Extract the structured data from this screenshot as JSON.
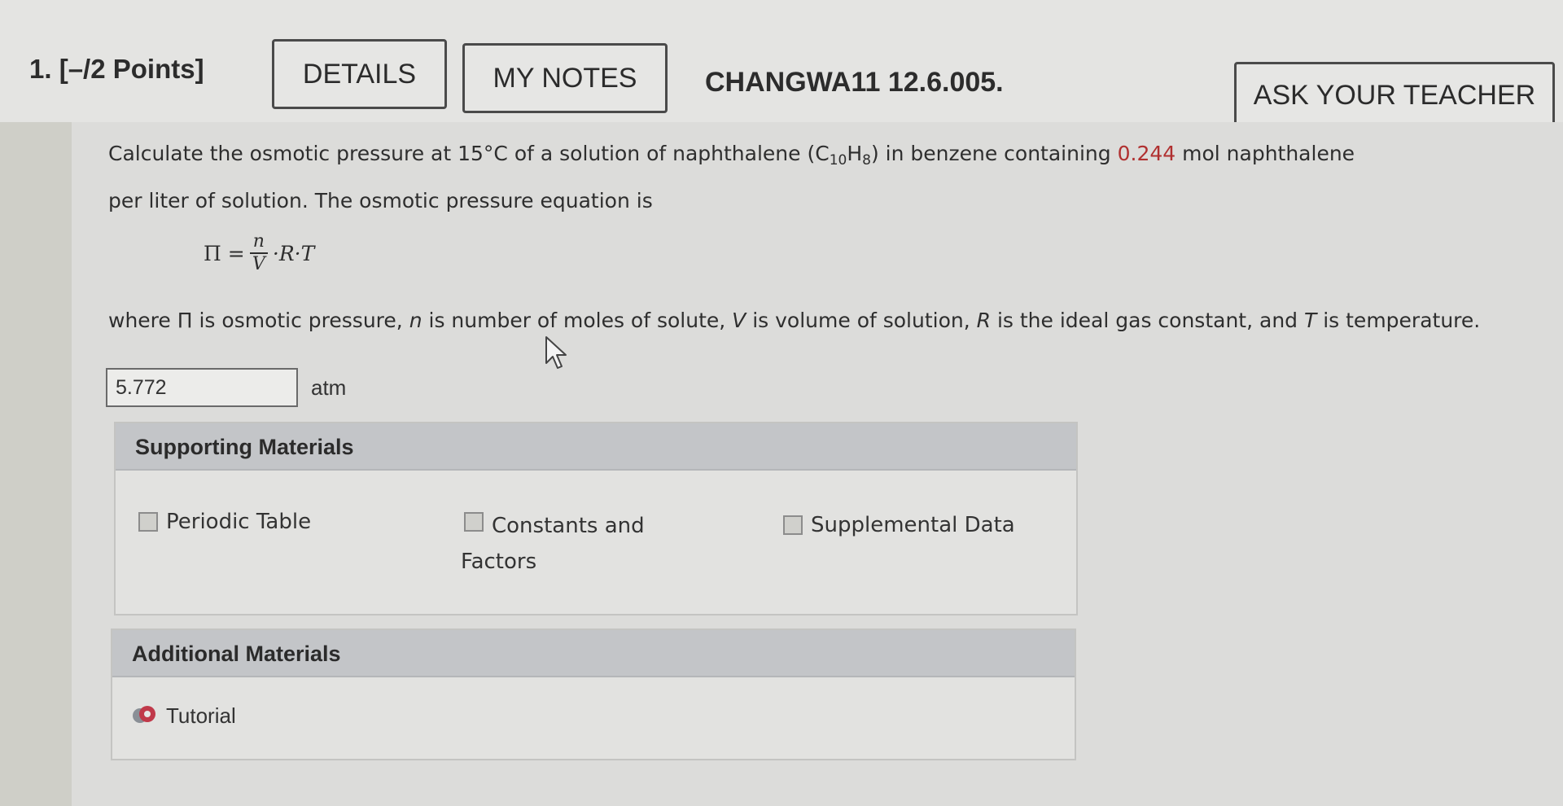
{
  "header": {
    "question_number": "1.",
    "points": "[–/2 Points]",
    "details_label": "DETAILS",
    "notes_label": "MY NOTES",
    "question_id": "CHANGWA11 12.6.005.",
    "ask_label": "ASK YOUR TEACHER"
  },
  "question": {
    "line1_a": "Calculate the osmotic pressure at ",
    "temp": "15°C",
    "line1_b": " of a solution of naphthalene (C",
    "sub_c": "10",
    "h": "H",
    "sub_h": "8",
    "line1_c": ") in benzene containing ",
    "amount": "0.244",
    "line1_d": " mol naphthalene",
    "line2": "per liter of solution. The osmotic pressure equation is",
    "eq_lhs": "Π =",
    "eq_num": "n",
    "eq_den": "V",
    "eq_rhs": "·R·T",
    "where_a": "where Π is osmotic pressure, ",
    "where_n": "n",
    "where_b": " is number of moles of solute, ",
    "where_v": "V",
    "where_c": " is volume of solution, ",
    "where_r": "R",
    "where_d": " is the ideal gas constant, and ",
    "where_t": "T",
    "where_e": " is temperature."
  },
  "answer": {
    "value": "5.772",
    "unit": "atm"
  },
  "supporting": {
    "title": "Supporting Materials",
    "items": [
      "Periodic Table",
      "Constants and",
      "Factors",
      "Supplemental Data"
    ]
  },
  "additional": {
    "title": "Additional Materials",
    "items": [
      "Tutorial"
    ]
  },
  "icons": {
    "material": "document-icon",
    "tutorial": "tutorial-icon",
    "pointer": "mouse-pointer-icon"
  }
}
